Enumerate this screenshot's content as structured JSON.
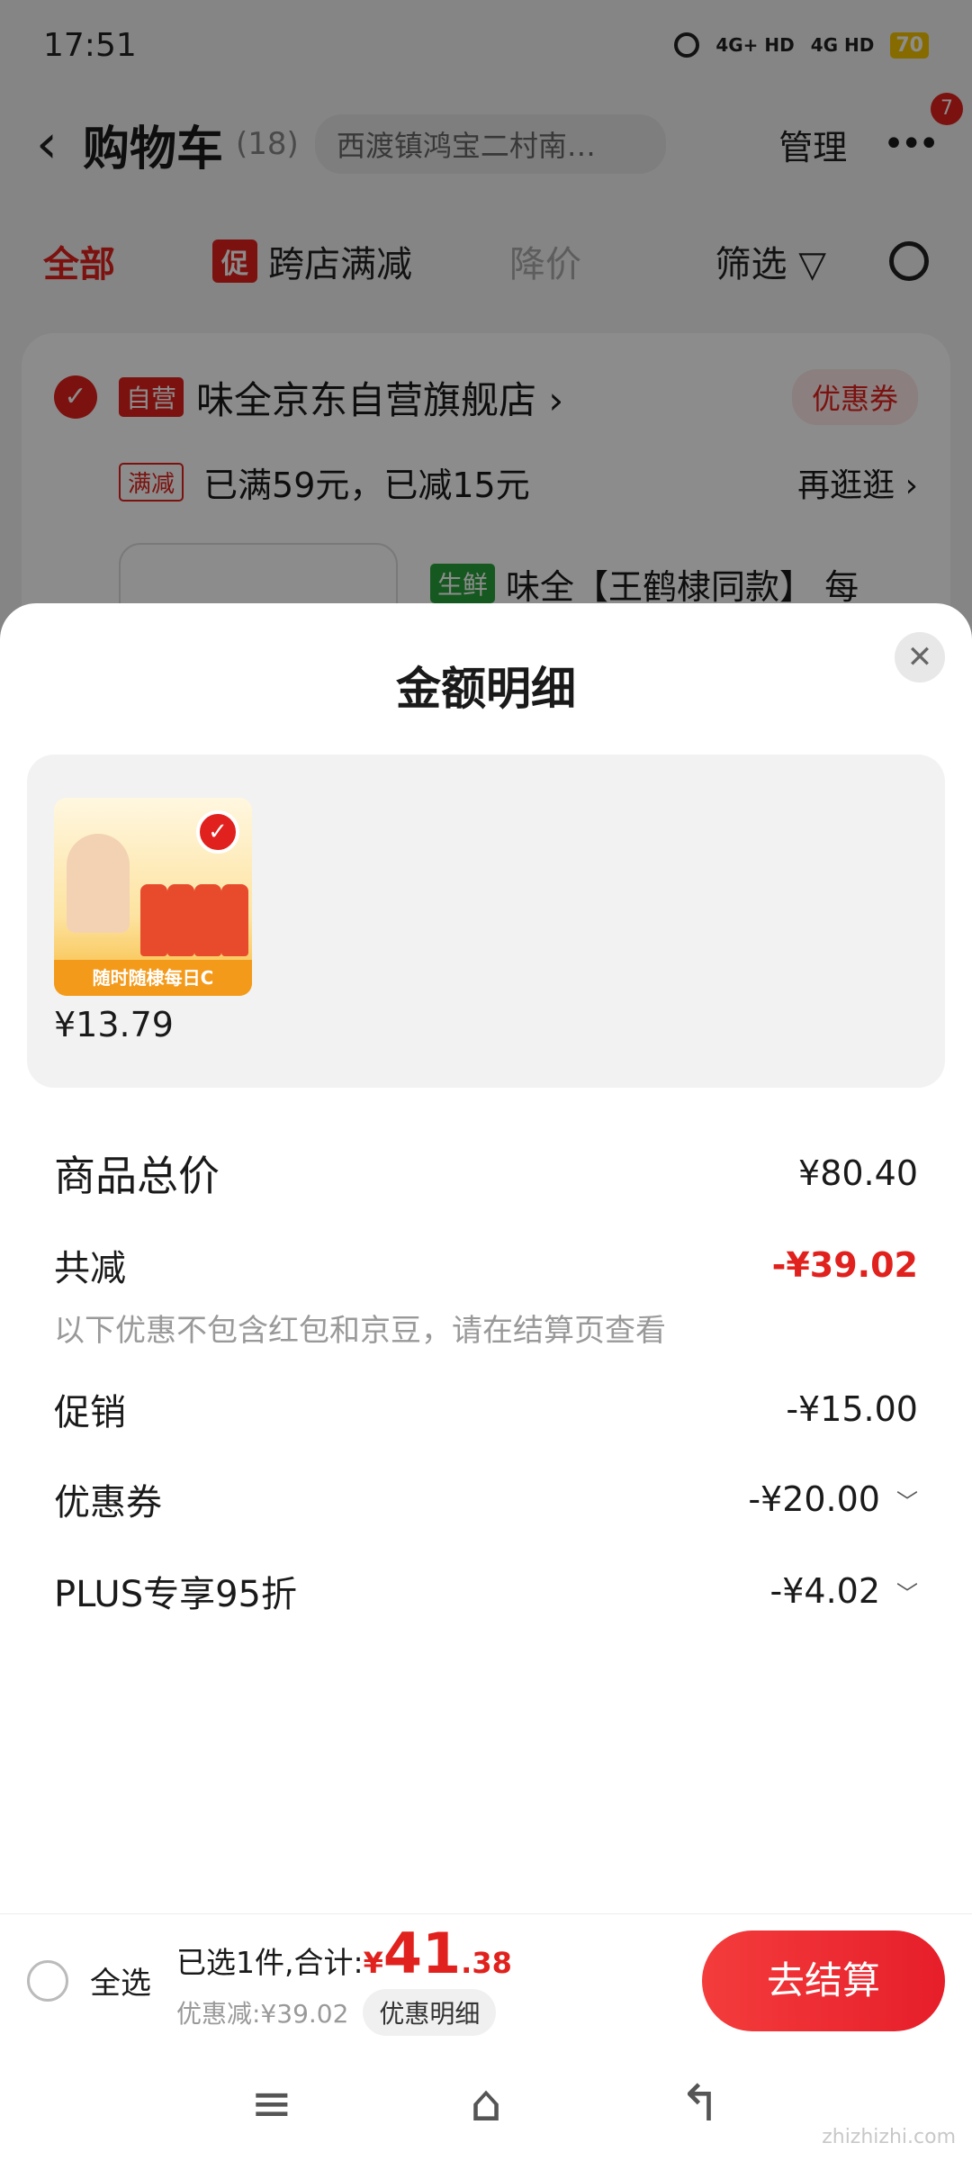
{
  "status_bar": {
    "time": "17:51",
    "network1": "4G+ HD",
    "network2": "4G HD",
    "battery": "70"
  },
  "header": {
    "back_icon": "chevron-left-icon",
    "title": "购物车",
    "count": "(18)",
    "address": "西渡镇鸿宝二村南…",
    "manage": "管理",
    "badge": "7"
  },
  "tabs": {
    "all": "全部",
    "promo_tag": "促",
    "promo": "跨店满减",
    "price_drop": "降价",
    "filter": "筛选"
  },
  "store": {
    "self_tag": "自营",
    "name": "味全京东自营旗舰店 ›",
    "coupon": "优惠券",
    "promo_tag": "满减",
    "promo_text": "已满59元，已减15元",
    "more_shop": "再逛逛 ›",
    "fresh_tag": "生鲜",
    "item_title": "味全【王鹤棣同款】 每"
  },
  "sheet": {
    "title": "金额明细",
    "goods": {
      "price": "¥13.79",
      "strip_text": "随时随棣每日C"
    },
    "rows": {
      "total_label": "商品总价",
      "total_value": "¥80.40",
      "reduce_label": "共减",
      "reduce_value": "-¥39.02",
      "note": "以下优惠不包含红包和京豆，请在结算页查看",
      "promo_label": "促销",
      "promo_value": "-¥15.00",
      "coupon_label": "优惠券",
      "coupon_value": "-¥20.00",
      "plus_label": "PLUS专享95折",
      "plus_value": "-¥4.02"
    }
  },
  "checkout": {
    "select_all": "全选",
    "selected_text": "已选1件,合计:",
    "currency": "¥",
    "total_int": "41",
    "total_dec": ".38",
    "discount_text": "优惠减:¥39.02",
    "detail_button": "优惠明细",
    "pay_button": "去结算"
  },
  "watermark": "zhizhizhi.com",
  "colors": {
    "accent": "#e0211d",
    "green": "#29a33b"
  }
}
